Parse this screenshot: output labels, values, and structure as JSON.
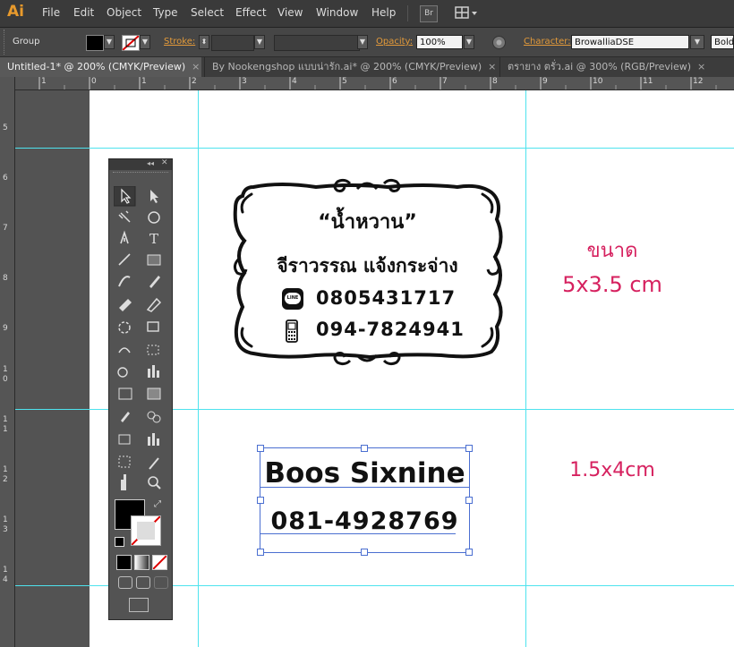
{
  "app": {
    "logo": "Ai"
  },
  "menu": [
    "File",
    "Edit",
    "Object",
    "Type",
    "Select",
    "Effect",
    "View",
    "Window",
    "Help"
  ],
  "menu_extra": {
    "bridge": "Br"
  },
  "control": {
    "selection": "Group",
    "stroke_label": "Stroke:",
    "opacity_label": "Opacity:",
    "opacity_value": "100%",
    "character_label": "Character:",
    "font_value": "BrowalliaDSE",
    "style_value": "Bold"
  },
  "tabs": [
    {
      "label": "Untitled-1* @ 200% (CMYK/Preview)",
      "close": "×"
    },
    {
      "label": "By Nookengshop แบบน่ารัก.ai* @ 200% (CMYK/Preview)",
      "close": "×"
    },
    {
      "label": "ตรายาง ตรั่ว.ai @ 300% (RGB/Preview)",
      "close": "×"
    }
  ],
  "ruler_h": [
    "1",
    "0",
    "1",
    "2",
    "3",
    "4",
    "5",
    "6",
    "7",
    "8",
    "9",
    "10",
    "11",
    "12"
  ],
  "ruler_v": [
    "5",
    "6",
    "7",
    "8",
    "9",
    "1",
    "0",
    "1",
    "1",
    "1",
    "2",
    "1",
    "3",
    "1",
    "4"
  ],
  "stamp1": {
    "name": "“น้ำหวาน”",
    "fullname": "จีราวรรณ  แจ้งกระจ่าง",
    "line_badge": "LINE",
    "phone1": "0805431717",
    "phone2": "094-7824941"
  },
  "size1": {
    "line1": "ขนาด",
    "line2": "5x3.5  cm"
  },
  "stamp2": {
    "name": "Boos Sixnine",
    "phone": "081-4928769"
  },
  "size2": {
    "label": "1.5x4cm"
  },
  "colors": {
    "guide": "#4ee3ee",
    "size_text": "#d6215f",
    "selection": "#4b6fd1",
    "accent_label": "#e39a3a"
  },
  "icons": [
    "menu-workspace-icon",
    "recolor-icon",
    "line-icon",
    "mobile-phone-icon",
    "stamp-frame-icon"
  ]
}
